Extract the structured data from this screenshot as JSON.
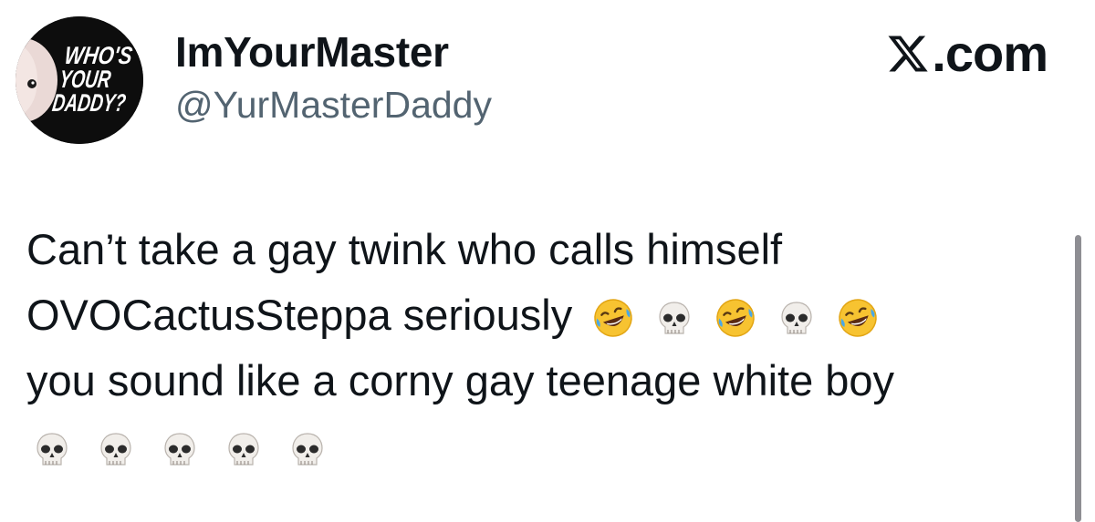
{
  "tweet": {
    "avatar": {
      "icon": "whos-your-daddy-avatar-icon",
      "logo_text": [
        "WHO'S",
        "YOUR",
        "DADDY?"
      ]
    },
    "display_name": "ImYourMaster",
    "handle": "@YurMasterDaddy",
    "text_lines": [
      "Can’t take a gay twink who calls himself",
      "OVOCactusSteppa seriously",
      "you sound like a corny gay teenage white boy"
    ],
    "line2_emojis": [
      "🤣",
      "💀",
      "🤣",
      "💀",
      "🤣"
    ],
    "line4_emojis": [
      "💀",
      "💀",
      "💀",
      "💀",
      "💀"
    ]
  },
  "brand": {
    "logo_icon": "x-logo-icon",
    "text": ".com"
  },
  "colors": {
    "text": "#0f1419",
    "handle": "#536471",
    "background": "#ffffff",
    "scrollbar": "#8e8e93"
  }
}
